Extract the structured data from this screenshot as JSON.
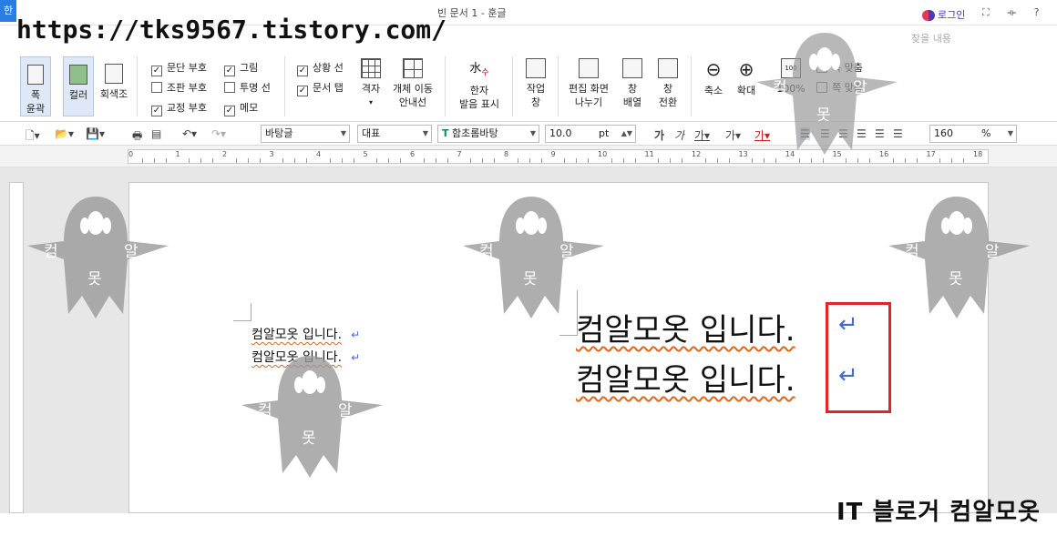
{
  "titlebar": {
    "app_logo": "한",
    "window_title": "빈 문서 1 - 훈글",
    "login_label": "로그인",
    "search_placeholder": "찾을 내용",
    "overlay_url": "https://tks9567.tistory.com/"
  },
  "ribbon": {
    "full_outline": "폭\n윤곽",
    "color": "컬러",
    "grayscale": "회색조",
    "checks": [
      {
        "label": "문단 부호",
        "checked": true
      },
      {
        "label": "조판 부호",
        "checked": false
      },
      {
        "label": "교정 부호",
        "checked": true
      },
      {
        "label": "그림",
        "checked": true
      },
      {
        "label": "투명 선",
        "checked": false
      },
      {
        "label": "메모",
        "checked": true
      },
      {
        "label": "상황 선",
        "checked": true
      },
      {
        "label": "문서 탭",
        "checked": true
      }
    ],
    "grid": "격자",
    "object_guide": "개체 이동\n안내선",
    "hanja": "한자\n발음 표시",
    "work_window": "작업\n창",
    "split_view": "편집 화면\n나누기",
    "arrange_window": "창\n배열",
    "switch_window": "창\n전환",
    "zoom_out": "축소",
    "zoom_in": "확대",
    "zoom_100": "100%",
    "fit_width": "폭 맞춤",
    "fit_page": "쪽 맞춤"
  },
  "format_bar": {
    "style": "바탕글",
    "lang": "대표",
    "font": "함초롬바탕",
    "size": "10.0",
    "size_unit": "pt",
    "zoom_value": "160",
    "zoom_unit": "%"
  },
  "ruler": {
    "numbers": [
      "0",
      "1",
      "2",
      "3",
      "4",
      "5",
      "6",
      "7",
      "8",
      "9",
      "10",
      "11",
      "12",
      "13",
      "14",
      "15",
      "16",
      "17",
      "18"
    ]
  },
  "document": {
    "line1": "컴알모옷 입니다.",
    "line2": "컴알모옷 입니다.",
    "zoom_line1": "컴알모옷 입니다.",
    "zoom_line2": "컴알모옷 입니다.",
    "return_mark": "↵"
  },
  "watermark": {
    "left": "컴",
    "right": "알",
    "bottom": "못"
  },
  "signature": "IT 블로거 컴알모옷"
}
